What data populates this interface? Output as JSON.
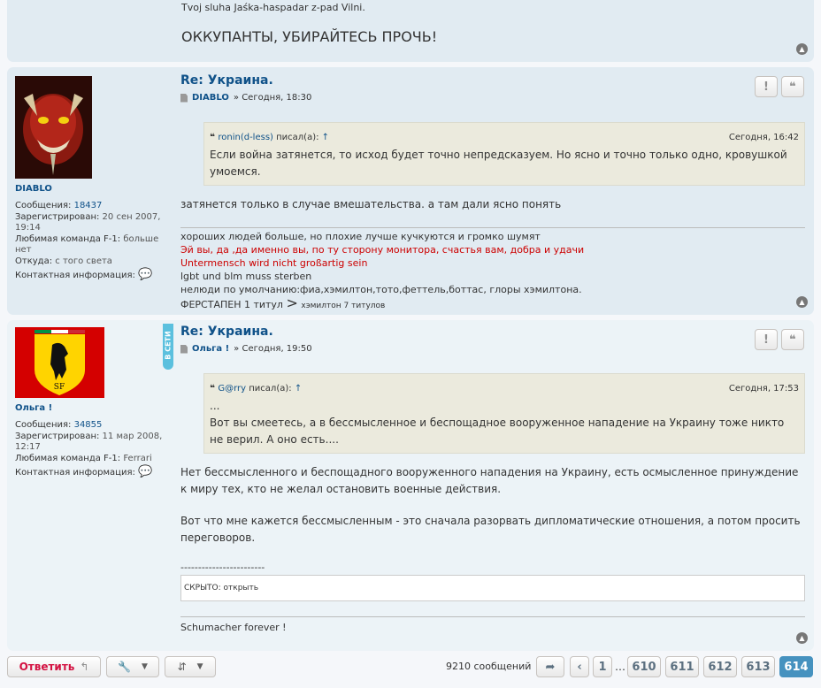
{
  "prev_post": {
    "line1": "Tvoj sluha Jaśka-haspadar z-pad Vilni.",
    "line2": "ОККУПАНТЫ, УБИРАЙТЕСЬ ПРОЧЬ!"
  },
  "post1": {
    "username": "DIABLO",
    "profile": {
      "messages_label": "Сообщения:",
      "messages": "18437",
      "registered_label": "Зарегистрирован:",
      "registered": "20 сен 2007, 19:14",
      "team_label": "Любимая команда F-1:",
      "team": "больше нет",
      "from_label": "Откуда:",
      "from": "с того света",
      "contact_label": "Контактная информация:"
    },
    "title": "Re: Украина.",
    "author": "DIABLO",
    "date": "» Сегодня, 18:30",
    "quote": {
      "who": "ronin(d-less)",
      "wrote": "писал(а):",
      "arrow": "↑",
      "date": "Сегодня, 16:42",
      "text": "Если война затянется, то исход будет точно непредсказуем. Но ясно и точно только одно, кровушкой умоемся."
    },
    "text": "затянется только в случае вмешательства. а там дали ясно понять",
    "sig": {
      "l1": "хороших людей больше, но плохие лучше кучкуются и громко шумят",
      "l2": "Эй вы, да ,да именно вы, по ту сторону монитора, счастья вам, добра и удачи",
      "l3": "Untermensch wird nicht großartig sein",
      "l4": "lgbt und blm muss sterben",
      "l5": "нелюди по умолчанию:фиа,хэмилтон,тото,феттель,боттас, глоры хэмилтона.",
      "l6a": "ФЕРСТАПЕН 1 титул",
      "l6b": ">",
      "l6c": "хэмилтон 7 титулов"
    }
  },
  "post2": {
    "username": "Ольга !",
    "online": "В СЕТИ",
    "profile": {
      "messages_label": "Сообщения:",
      "messages": "34855",
      "registered_label": "Зарегистрирован:",
      "registered": "11 мар 2008, 12:17",
      "team_label": "Любимая команда F-1:",
      "team": "Ferrari",
      "contact_label": "Контактная информация:"
    },
    "title": "Re: Украина.",
    "author": "Ольга !",
    "date": "» Сегодня, 19:50",
    "quote": {
      "who": "G@rry",
      "wrote": "писал(а):",
      "arrow": "↑",
      "date": "Сегодня, 17:53",
      "l1": "...",
      "l2": "Вот вы смеетесь, а в бессмысленное и беспощадное вооруженное нападение на Украину тоже никто не верил. А оно есть...."
    },
    "p1": "Нет бессмысленного и беспощадного вооруженного нападения на Украину, есть осмысленное принуждение к миру тех, кто не желал остановить военные действия.",
    "p2": "Вот что мне кажется бессмысленным - это сначала разорвать дипломатические отношения, а потом просить переговоров.",
    "dashes": "------------------------",
    "spoiler": "СКРЫТО: открыть",
    "sig": "Schumacher forever !"
  },
  "toolbar": {
    "reply_label": "Ответить",
    "count": "9210 сообщений",
    "ellipsis": "…",
    "pages": [
      "1",
      "610",
      "611",
      "612",
      "613",
      "614"
    ]
  }
}
